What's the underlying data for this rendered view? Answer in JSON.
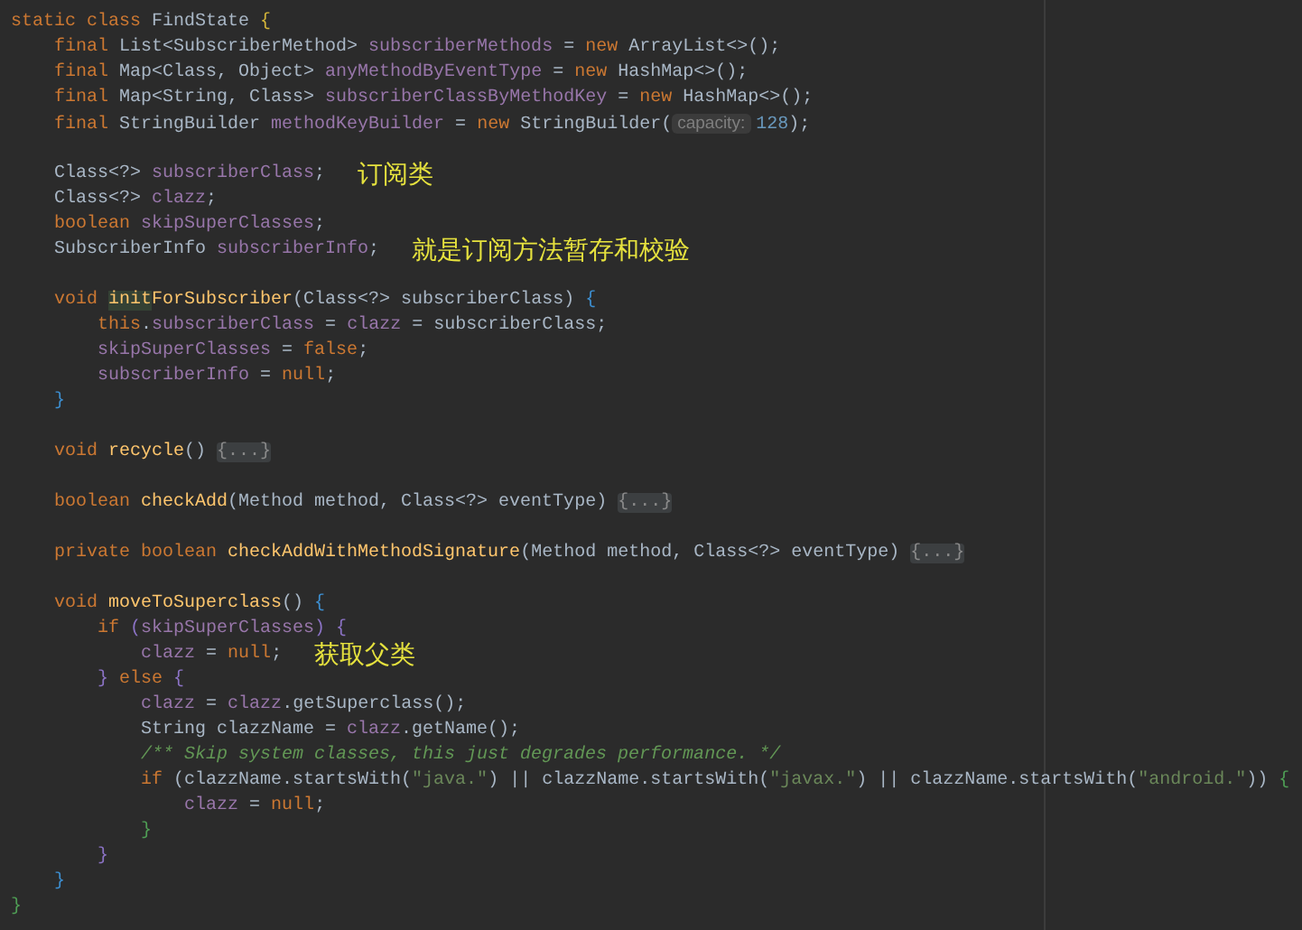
{
  "editor": {
    "lines": [
      {
        "kind": "code",
        "tokens": [
          {
            "text": "static class ",
            "kind": "keyword"
          },
          {
            "text": "FindState ",
            "kind": "plain"
          },
          {
            "text": "{",
            "kind": "brace_class"
          }
        ]
      },
      {
        "kind": "code",
        "tokens": [
          {
            "text": "    final ",
            "kind": "keyword"
          },
          {
            "text": "List<SubscriberMethod> ",
            "kind": "plain"
          },
          {
            "text": "subscriberMethods",
            "kind": "field"
          },
          {
            "text": " = ",
            "kind": "plain"
          },
          {
            "text": "new ",
            "kind": "keyword"
          },
          {
            "text": "ArrayList<>();",
            "kind": "plain"
          }
        ]
      },
      {
        "kind": "code",
        "tokens": [
          {
            "text": "    final ",
            "kind": "keyword"
          },
          {
            "text": "Map<Class, Object> ",
            "kind": "plain"
          },
          {
            "text": "anyMethodByEventType",
            "kind": "field"
          },
          {
            "text": " = ",
            "kind": "plain"
          },
          {
            "text": "new ",
            "kind": "keyword"
          },
          {
            "text": "HashMap<>();",
            "kind": "plain"
          }
        ]
      },
      {
        "kind": "code",
        "tokens": [
          {
            "text": "    final ",
            "kind": "keyword"
          },
          {
            "text": "Map<String, Class> ",
            "kind": "plain"
          },
          {
            "text": "subscriberClassByMethodKey",
            "kind": "field"
          },
          {
            "text": " = ",
            "kind": "plain"
          },
          {
            "text": "new ",
            "kind": "keyword"
          },
          {
            "text": "HashMap<>();",
            "kind": "plain"
          }
        ]
      },
      {
        "kind": "code",
        "tokens": [
          {
            "text": "    final ",
            "kind": "keyword"
          },
          {
            "text": "StringBuilder ",
            "kind": "plain"
          },
          {
            "text": "methodKeyBuilder",
            "kind": "field"
          },
          {
            "text": " = ",
            "kind": "plain"
          },
          {
            "text": "new ",
            "kind": "keyword"
          },
          {
            "text": "StringBuilder(",
            "kind": "plain"
          },
          {
            "text": "capacity:",
            "kind": "hint"
          },
          {
            "text": "128",
            "kind": "number"
          },
          {
            "text": ");",
            "kind": "plain"
          }
        ]
      },
      {
        "kind": "blank"
      },
      {
        "kind": "code",
        "note": "订阅类",
        "tokens": [
          {
            "text": "    Class<?> ",
            "kind": "plain"
          },
          {
            "text": "subscriberClass",
            "kind": "field"
          },
          {
            "text": ";",
            "kind": "plain"
          }
        ]
      },
      {
        "kind": "code",
        "tokens": [
          {
            "text": "    Class<?> ",
            "kind": "plain"
          },
          {
            "text": "clazz",
            "kind": "field"
          },
          {
            "text": ";",
            "kind": "plain"
          }
        ]
      },
      {
        "kind": "code",
        "tokens": [
          {
            "text": "    boolean ",
            "kind": "keyword"
          },
          {
            "text": "skipSuperClasses",
            "kind": "field"
          },
          {
            "text": ";",
            "kind": "plain"
          }
        ]
      },
      {
        "kind": "code",
        "note": "就是订阅方法暂存和校验",
        "tokens": [
          {
            "text": "    SubscriberInfo ",
            "kind": "plain"
          },
          {
            "text": "subscriberInfo",
            "kind": "field"
          },
          {
            "text": ";",
            "kind": "plain"
          }
        ]
      },
      {
        "kind": "blank"
      },
      {
        "kind": "code",
        "tokens": [
          {
            "text": "    void ",
            "kind": "keyword"
          },
          {
            "text": "init",
            "kind": "match"
          },
          {
            "text": "ForSubscriber",
            "kind": "method"
          },
          {
            "text": "(Class<?> subscriberClass) ",
            "kind": "plain"
          },
          {
            "text": "{",
            "kind": "brace_method"
          }
        ]
      },
      {
        "kind": "code",
        "tokens": [
          {
            "text": "        this",
            "kind": "keyword"
          },
          {
            "text": ".",
            "kind": "plain"
          },
          {
            "text": "subscriberClass",
            "kind": "field"
          },
          {
            "text": " = ",
            "kind": "plain"
          },
          {
            "text": "clazz",
            "kind": "field"
          },
          {
            "text": " = subscriberClass;",
            "kind": "plain"
          }
        ]
      },
      {
        "kind": "code",
        "tokens": [
          {
            "text": "        skipSuperClasses",
            "kind": "field"
          },
          {
            "text": " = ",
            "kind": "plain"
          },
          {
            "text": "false",
            "kind": "keyword"
          },
          {
            "text": ";",
            "kind": "plain"
          }
        ]
      },
      {
        "kind": "code",
        "tokens": [
          {
            "text": "        subscriberInfo",
            "kind": "field"
          },
          {
            "text": " = ",
            "kind": "plain"
          },
          {
            "text": "null",
            "kind": "keyword"
          },
          {
            "text": ";",
            "kind": "plain"
          }
        ]
      },
      {
        "kind": "code",
        "tokens": [
          {
            "text": "    }",
            "kind": "brace_method"
          }
        ]
      },
      {
        "kind": "blank"
      },
      {
        "kind": "code",
        "tokens": [
          {
            "text": "    void ",
            "kind": "keyword"
          },
          {
            "text": "recycle",
            "kind": "method"
          },
          {
            "text": "() ",
            "kind": "plain"
          },
          {
            "text": "{...}",
            "kind": "fold"
          }
        ]
      },
      {
        "kind": "blank"
      },
      {
        "kind": "code",
        "tokens": [
          {
            "text": "    boolean ",
            "kind": "keyword"
          },
          {
            "text": "checkAdd",
            "kind": "method"
          },
          {
            "text": "(Method method, Class<?> eventType) ",
            "kind": "plain"
          },
          {
            "text": "{...}",
            "kind": "fold"
          }
        ]
      },
      {
        "kind": "blank"
      },
      {
        "kind": "code",
        "tokens": [
          {
            "text": "    private boolean ",
            "kind": "keyword"
          },
          {
            "text": "checkAddWithMethodSignature",
            "kind": "method"
          },
          {
            "text": "(Method method, Class<?> eventType) ",
            "kind": "plain"
          },
          {
            "text": "{...}",
            "kind": "fold"
          }
        ]
      },
      {
        "kind": "blank"
      },
      {
        "kind": "code",
        "tokens": [
          {
            "text": "    void ",
            "kind": "keyword"
          },
          {
            "text": "moveToSuperclass",
            "kind": "method"
          },
          {
            "text": "() ",
            "kind": "plain"
          },
          {
            "text": "{",
            "kind": "brace_method"
          }
        ]
      },
      {
        "kind": "code",
        "tokens": [
          {
            "text": "        if ",
            "kind": "keyword"
          },
          {
            "text": "(",
            "kind": "brace_if"
          },
          {
            "text": "skipSuperClasses",
            "kind": "field"
          },
          {
            "text": ") {",
            "kind": "brace_if"
          }
        ]
      },
      {
        "kind": "code",
        "note": "获取父类",
        "tokens": [
          {
            "text": "            clazz",
            "kind": "field"
          },
          {
            "text": " = ",
            "kind": "plain"
          },
          {
            "text": "null",
            "kind": "keyword"
          },
          {
            "text": ";",
            "kind": "plain"
          }
        ]
      },
      {
        "kind": "code",
        "tokens": [
          {
            "text": "        } ",
            "kind": "brace_if"
          },
          {
            "text": "else ",
            "kind": "keyword"
          },
          {
            "text": "{",
            "kind": "brace_if"
          }
        ]
      },
      {
        "kind": "code",
        "tokens": [
          {
            "text": "            clazz",
            "kind": "field"
          },
          {
            "text": " = ",
            "kind": "plain"
          },
          {
            "text": "clazz",
            "kind": "field"
          },
          {
            "text": ".getSuperclass();",
            "kind": "plain"
          }
        ]
      },
      {
        "kind": "code",
        "tokens": [
          {
            "text": "            String clazzName = ",
            "kind": "plain"
          },
          {
            "text": "clazz",
            "kind": "field"
          },
          {
            "text": ".getName();",
            "kind": "plain"
          }
        ]
      },
      {
        "kind": "code",
        "tokens": [
          {
            "text": "            /** Skip system classes, this just degrades performance. */",
            "kind": "comment"
          }
        ]
      },
      {
        "kind": "code",
        "tokens": [
          {
            "text": "            if ",
            "kind": "keyword"
          },
          {
            "text": "(clazzName.startsWith(",
            "kind": "plain"
          },
          {
            "text": "\"java.\"",
            "kind": "string"
          },
          {
            "text": ") || clazzName.startsWith(",
            "kind": "plain"
          },
          {
            "text": "\"javax.\"",
            "kind": "string"
          },
          {
            "text": ") || clazzName.startsWith(",
            "kind": "plain"
          },
          {
            "text": "\"android.\"",
            "kind": "string"
          },
          {
            "text": ")) ",
            "kind": "plain"
          },
          {
            "text": "{",
            "kind": "brace_inner"
          }
        ]
      },
      {
        "kind": "code",
        "tokens": [
          {
            "text": "                clazz",
            "kind": "field"
          },
          {
            "text": " = ",
            "kind": "plain"
          },
          {
            "text": "null",
            "kind": "keyword"
          },
          {
            "text": ";",
            "kind": "plain"
          }
        ]
      },
      {
        "kind": "code",
        "tokens": [
          {
            "text": "            }",
            "kind": "brace_inner"
          }
        ]
      },
      {
        "kind": "code",
        "tokens": [
          {
            "text": "        }",
            "kind": "brace_if"
          }
        ]
      },
      {
        "kind": "code",
        "tokens": [
          {
            "text": "    }",
            "kind": "brace_method"
          }
        ]
      },
      {
        "kind": "code",
        "tokens": [
          {
            "text": "}",
            "kind": "brace_inner"
          }
        ]
      }
    ]
  }
}
